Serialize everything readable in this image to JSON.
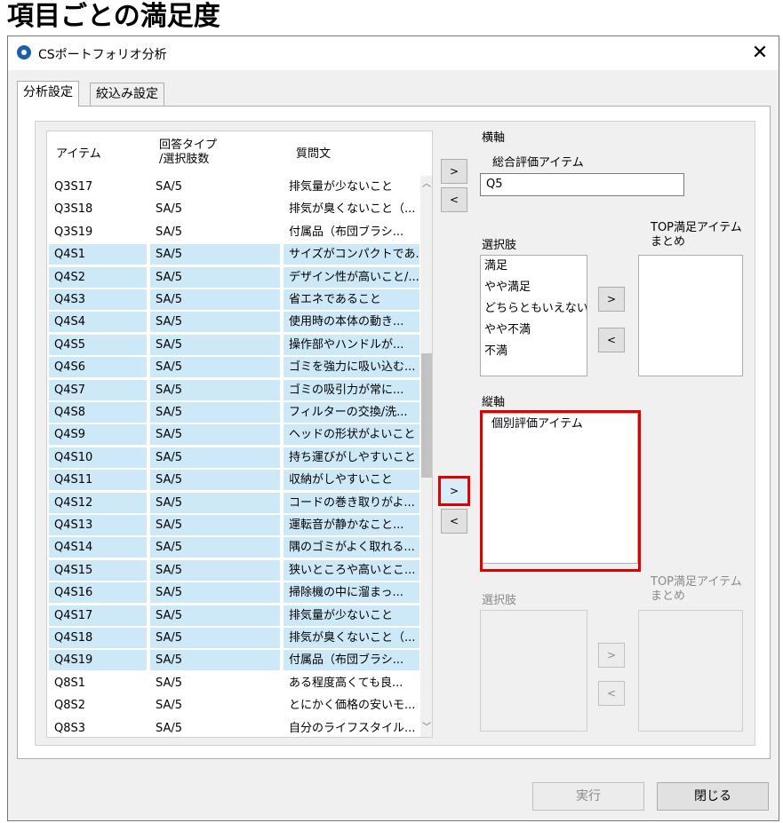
{
  "page_title": "項目ごとの満足度",
  "window": {
    "title": "CSポートフォリオ分析",
    "close_label": "✕"
  },
  "tabs": [
    {
      "label": "分析設定",
      "active": true
    },
    {
      "label": "絞込み設定",
      "active": false
    }
  ],
  "item_list": {
    "headers": {
      "item": "アイテム",
      "type_line1": "回答タイプ",
      "type_line2": "/選択肢数",
      "question": "質問文"
    },
    "rows": [
      {
        "item": "Q3S17",
        "type": "SA/5",
        "question": "排気量が少ないこと",
        "selected": false
      },
      {
        "item": "Q3S18",
        "type": "SA/5",
        "question": "排気が臭くないこと（...",
        "selected": false
      },
      {
        "item": "Q3S19",
        "type": "SA/5",
        "question": "付属品（布団ブラシ...",
        "selected": false
      },
      {
        "item": "Q4S1",
        "type": "SA/5",
        "question": "サイズがコンパクトであ...",
        "selected": true
      },
      {
        "item": "Q4S2",
        "type": "SA/5",
        "question": "デザイン性が高いこと/...",
        "selected": true
      },
      {
        "item": "Q4S3",
        "type": "SA/5",
        "question": "省エネであること",
        "selected": true
      },
      {
        "item": "Q4S4",
        "type": "SA/5",
        "question": "使用時の本体の動き...",
        "selected": true
      },
      {
        "item": "Q4S5",
        "type": "SA/5",
        "question": "操作部やハンドルが...",
        "selected": true
      },
      {
        "item": "Q4S6",
        "type": "SA/5",
        "question": "ゴミを強力に吸い込む...",
        "selected": true
      },
      {
        "item": "Q4S7",
        "type": "SA/5",
        "question": "ゴミの吸引力が常に...",
        "selected": true
      },
      {
        "item": "Q4S8",
        "type": "SA/5",
        "question": "フィルターの交換/洗...",
        "selected": true
      },
      {
        "item": "Q4S9",
        "type": "SA/5",
        "question": "ヘッドの形状がよいこと",
        "selected": true
      },
      {
        "item": "Q4S10",
        "type": "SA/5",
        "question": "持ち運びがしやすいこと",
        "selected": true
      },
      {
        "item": "Q4S11",
        "type": "SA/5",
        "question": "収納がしやすいこと",
        "selected": true
      },
      {
        "item": "Q4S12",
        "type": "SA/5",
        "question": "コードの巻き取りがよ...",
        "selected": true
      },
      {
        "item": "Q4S13",
        "type": "SA/5",
        "question": "運転音が静かなこと...",
        "selected": true
      },
      {
        "item": "Q4S14",
        "type": "SA/5",
        "question": "隅のゴミがよく取れる...",
        "selected": true
      },
      {
        "item": "Q4S15",
        "type": "SA/5",
        "question": "狭いところや高いとこ...",
        "selected": true
      },
      {
        "item": "Q4S16",
        "type": "SA/5",
        "question": "掃除機の中に溜まっ...",
        "selected": true
      },
      {
        "item": "Q4S17",
        "type": "SA/5",
        "question": "排気量が少ないこと",
        "selected": true
      },
      {
        "item": "Q4S18",
        "type": "SA/5",
        "question": "排気が臭くないこと（...",
        "selected": true
      },
      {
        "item": "Q4S19",
        "type": "SA/5",
        "question": "付属品（布団ブラシ...",
        "selected": true
      },
      {
        "item": "Q8S1",
        "type": "SA/5",
        "question": "ある程度高くても良...",
        "selected": false
      },
      {
        "item": "Q8S2",
        "type": "SA/5",
        "question": "とにかく価格の安いモ...",
        "selected": false
      },
      {
        "item": "Q8S3",
        "type": "SA/5",
        "question": "自分のライフスタイル...",
        "selected": false
      }
    ]
  },
  "horizontal_axis": {
    "label": "横軸",
    "sub_label": "総合評価アイテム",
    "value": "Q5",
    "choices_label": "選択肢",
    "choices": [
      "満足",
      "やや満足",
      "どちらともいえない",
      "やや不満",
      "不満"
    ],
    "top_label_line1": "TOP満足アイテム",
    "top_label_line2": "まとめ"
  },
  "vertical_axis": {
    "label": "縦軸",
    "items": [
      "個別評価アイテム"
    ],
    "choices_label": "選択肢",
    "top_label_line1": "TOP満足アイテム",
    "top_label_line2": "まとめ"
  },
  "buttons": {
    "add": ">",
    "remove": "<",
    "run": "実行",
    "close": "閉じる"
  }
}
